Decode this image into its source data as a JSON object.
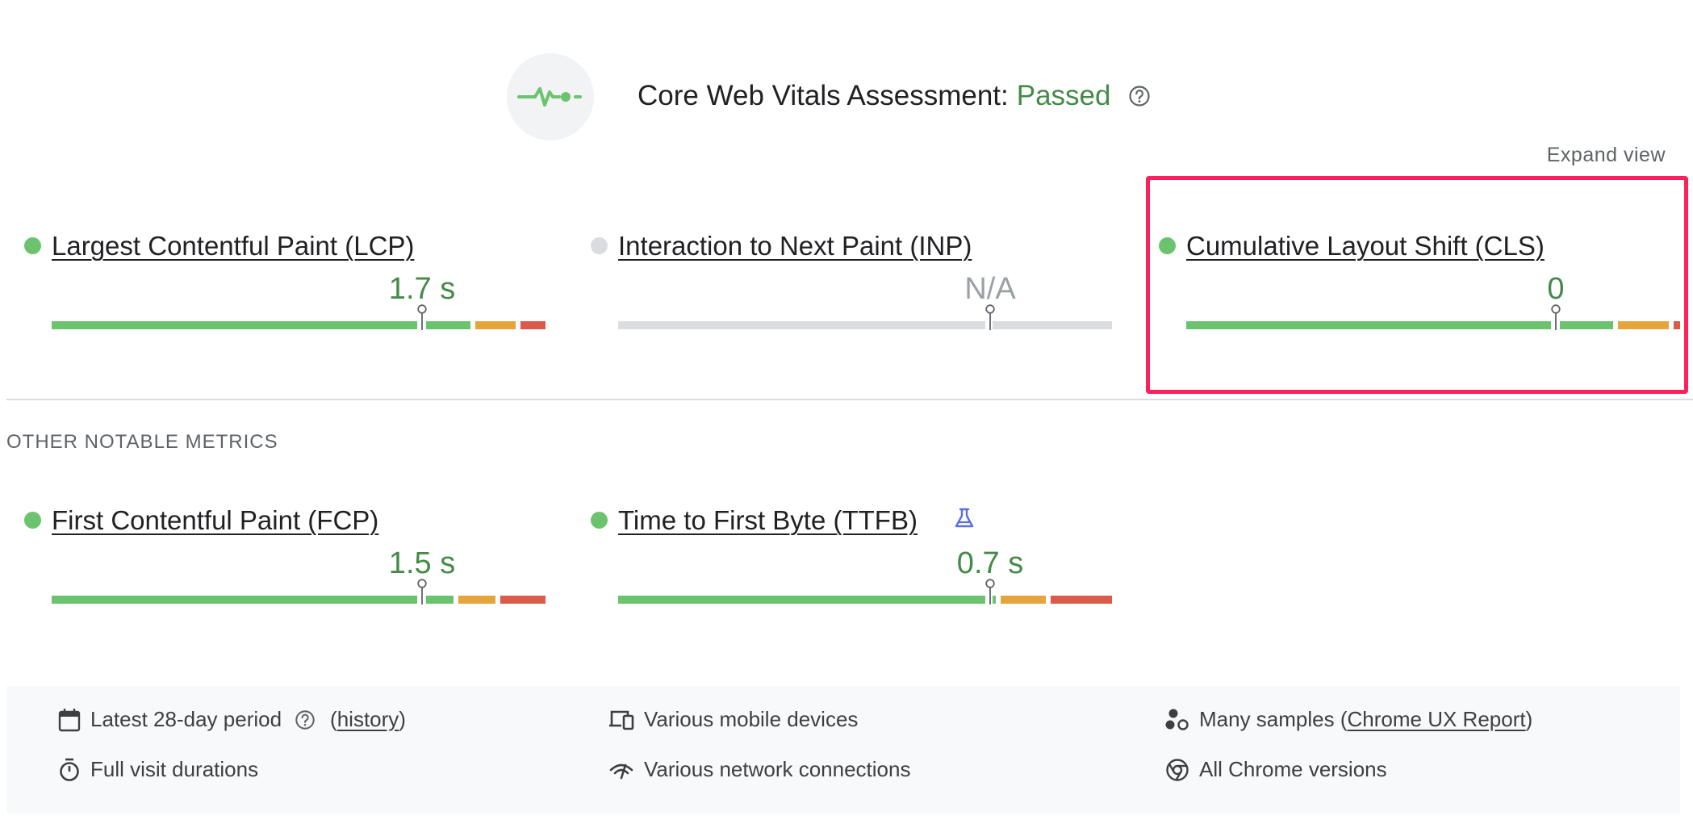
{
  "header": {
    "title": "Core Web Vitals Assessment:",
    "status": "Passed",
    "expand_label": "Expand view"
  },
  "colors": {
    "good": "#6cc36d",
    "needs_improvement": "#e6a53c",
    "poor": "#db5a4a",
    "na": "#dadce0",
    "highlight": "#ff1f5a",
    "good_text": "#448a48"
  },
  "core_metrics": [
    {
      "name": "Largest Contentful Paint (LCP)",
      "value": "1.7 s",
      "status": "good"
    },
    {
      "name": "Interaction to Next Paint (INP)",
      "value": "N/A",
      "status": "na"
    },
    {
      "name": "Cumulative Layout Shift (CLS)",
      "value": "0",
      "status": "good"
    }
  ],
  "other_section_title": "OTHER NOTABLE METRICS",
  "other_metrics": [
    {
      "name": "First Contentful Paint (FCP)",
      "value": "1.5 s",
      "status": "good"
    },
    {
      "name": "Time to First Byte (TTFB)",
      "value": "0.7 s",
      "status": "good",
      "icon": "lab-flask-icon"
    }
  ],
  "footer": {
    "period": {
      "text": "Latest 28-day period",
      "open": "(",
      "link": "history",
      "close": ")"
    },
    "devices": "Various mobile devices",
    "samples": {
      "text": "Many samples (",
      "link": "Chrome UX Report",
      "close": ")"
    },
    "durations": "Full visit durations",
    "network": "Various network connections",
    "versions": "All Chrome versions"
  }
}
